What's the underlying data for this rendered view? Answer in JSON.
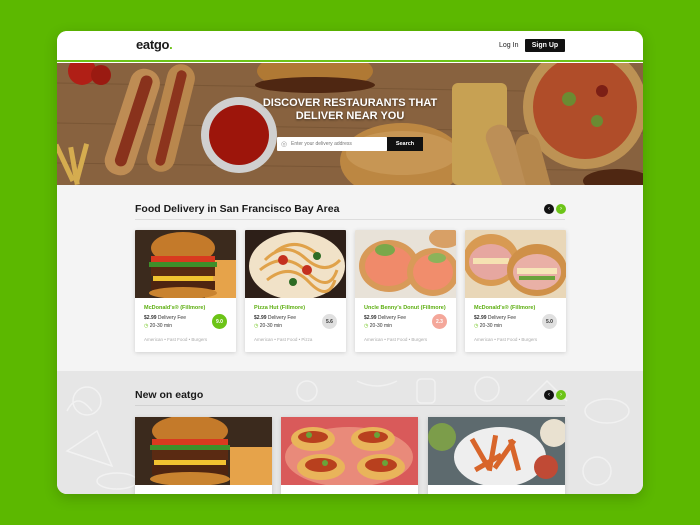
{
  "header": {
    "logo_main": "eatgo",
    "logo_dot": ".",
    "login_label": "Log In",
    "signup_label": "Sign Up"
  },
  "hero": {
    "title": "DISCOVER RESTAURANTS THAT DELIVER NEAR YOU",
    "search_placeholder": "Enter your delivery address",
    "search_button": "Search"
  },
  "section_delivery": {
    "title": "Food Delivery in San Francisco Bay Area",
    "restaurants": [
      {
        "name": "McDonald's® (Fillmore)",
        "fee_amount": "$2.99",
        "fee_label": "Delivery Fee",
        "time": "20-30 min",
        "rating": "9.0",
        "tags": "American • Fast Food • Burgers",
        "image": "burger"
      },
      {
        "name": "Pizza Hut (Fillmore)",
        "fee_amount": "$2.99",
        "fee_label": "Delivery Fee",
        "time": "20-30 min",
        "rating": "5.6",
        "tags": "American • Fast Food • Pizza",
        "image": "pasta"
      },
      {
        "name": "Uncle Benny's Donut (Fillmore)",
        "fee_amount": "$2.99",
        "fee_label": "Delivery Fee",
        "time": "20-30 min",
        "rating": "2.3",
        "tags": "American • Fast Food • Burgers",
        "image": "bagel-salmon"
      },
      {
        "name": "McDonald's® (Fillmore)",
        "fee_amount": "$2.99",
        "fee_label": "Delivery Fee",
        "time": "20-30 min",
        "rating": "5.0",
        "tags": "American • Fast Food • Burgers",
        "image": "sandwich"
      }
    ],
    "prev_icon": "chevron-left-icon",
    "next_icon": "chevron-right-icon"
  },
  "section_new": {
    "title": "New on eatgo",
    "items": [
      {
        "image": "burger"
      },
      {
        "image": "tacos"
      },
      {
        "image": "fries-salad"
      }
    ]
  },
  "colors": {
    "brand_green": "#6cc417",
    "background_green": "#5cb800",
    "rating_high": "#6cc417",
    "rating_mid": "#e0e0e0",
    "rating_low": "#f4a79a"
  }
}
